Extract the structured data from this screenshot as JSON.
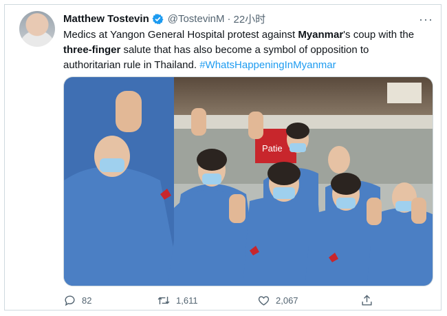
{
  "tweet": {
    "author_name": "Matthew Tostevin",
    "handle": "@TostevinM",
    "separator": "·",
    "time": "22小时",
    "more_label": "···",
    "text": {
      "p1": "Medics at Yangon General Hospital protest against ",
      "b1": "Myanmar",
      "p2": "'s coup with the ",
      "b2": "three-finger",
      "p3": " salute that has also become a symbol of opposition to authoritarian rule in Thailand. ",
      "hashtag": "#WhatsHappeningInMyanmar"
    },
    "image_sign_text": "Patie"
  },
  "actions": {
    "reply_count": "82",
    "retweet_count": "1,611",
    "like_count": "2,067"
  },
  "colors": {
    "accent": "#1d9bf0",
    "gown": "#4b7fc4",
    "mask": "#9fd0ee",
    "banner": "#c8262c"
  },
  "icons": [
    "more-icon",
    "verified-icon",
    "reply-icon",
    "retweet-icon",
    "like-icon",
    "share-icon"
  ]
}
